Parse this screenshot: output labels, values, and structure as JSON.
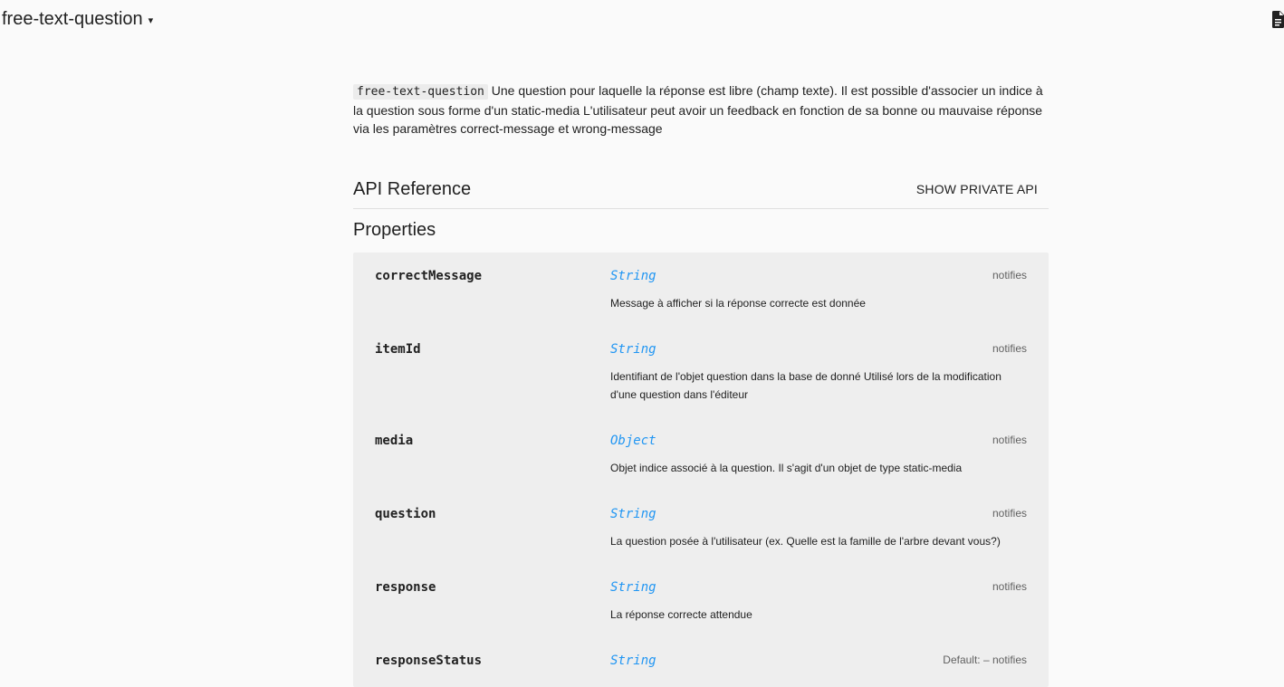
{
  "topbar": {
    "element_name": "free-text-question",
    "caret": "▾",
    "doc_icon": "document-icon"
  },
  "description": {
    "code": "free-text-question",
    "text": " Une question pour laquelle la réponse est libre (champ texte). Il est possible d'associer un indice à la question sous forme d'un static-media L'utilisateur peut avoir un feedback en fonction de sa bonne ou mauvaise réponse via les paramètres correct-message et wrong-message"
  },
  "api": {
    "title": "API Reference",
    "show_private_label": "SHOW PRIVATE API"
  },
  "properties": {
    "title": "Properties",
    "items": [
      {
        "name": "correctMessage",
        "type": "String",
        "meta": "notifies",
        "desc": "Message à afficher si la réponse correcte est donnée"
      },
      {
        "name": "itemId",
        "type": "String",
        "meta": "notifies",
        "desc": "Identifiant de l'objet question dans la base de donné Utilisé lors de la modification d'une question dans l'éditeur"
      },
      {
        "name": "media",
        "type": "Object",
        "meta": "notifies",
        "desc": "Objet indice associé à la question. Il s'agit d'un objet de type static-media"
      },
      {
        "name": "question",
        "type": "String",
        "meta": "notifies",
        "desc": "La question posée à l'utilisateur (ex. Quelle est la famille de l'arbre devant vous?)"
      },
      {
        "name": "response",
        "type": "String",
        "meta": "notifies",
        "desc": "La réponse correcte attendue"
      },
      {
        "name": "responseStatus",
        "type": "String",
        "meta": "Default: – notifies",
        "desc": ""
      }
    ]
  }
}
